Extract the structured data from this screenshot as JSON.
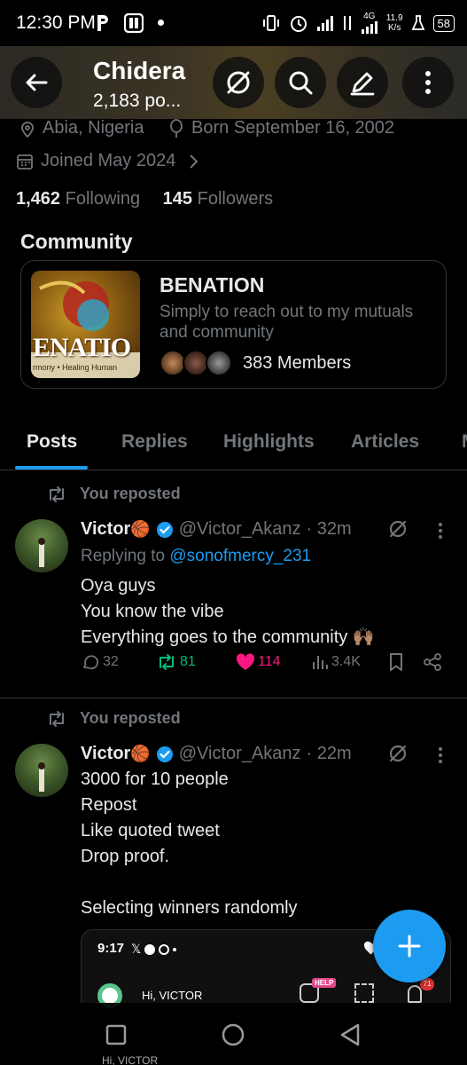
{
  "status": {
    "time": "12:30 PM",
    "network": "4G",
    "speed_value": "11.9",
    "speed_unit": "K/s",
    "battery": "58"
  },
  "header": {
    "name": "Chidera",
    "posts": "2,183 po..."
  },
  "profile": {
    "location": "Abia, Nigeria",
    "born": "Born September 16, 2002",
    "joined": "Joined May 2024",
    "following_count": "1,462",
    "following_label": "Following",
    "followers_count": "145",
    "followers_label": "Followers"
  },
  "community": {
    "section_title": "Community",
    "name": "BENATION",
    "description": "Simply to reach out to my mutuals and community",
    "members": "383 Members",
    "image_text_main": "ENATIO",
    "image_text_sub": "rmony • Healing Human"
  },
  "tabs": [
    "Posts",
    "Replies",
    "Highlights",
    "Articles"
  ],
  "posts": [
    {
      "repost_label": "You reposted",
      "author": "Victor",
      "author_emoji": "🏀",
      "handle": "@Victor_Akanz",
      "time": "· 32m",
      "replying_prefix": "Replying to",
      "replying_to": "@sonofmercy_231",
      "lines": [
        "Oya guys",
        "You know the vibe",
        "Everything goes to the community 🙌🏽"
      ],
      "replies": "32",
      "reposts": "81",
      "likes": "114",
      "views": "3.4K"
    },
    {
      "repost_label": "You reposted",
      "author": "Victor",
      "author_emoji": "🏀",
      "handle": "@Victor_Akanz",
      "time": "· 22m",
      "lines": [
        "3000 for 10 people",
        "Repost",
        "Like quoted tweet",
        "Drop proof.",
        "",
        "Selecting winners randomly"
      ],
      "embed": {
        "time": "9:17",
        "greeting": "Hi, VICTOR",
        "help": "HELP",
        "badge": "71",
        "greeting_bottom": "Hi, VICTOR"
      }
    }
  ],
  "colors": {
    "accent": "#1d9bf0",
    "repost_green": "#00ba7c",
    "like_pink": "#f91880",
    "muted": "#71767b"
  }
}
